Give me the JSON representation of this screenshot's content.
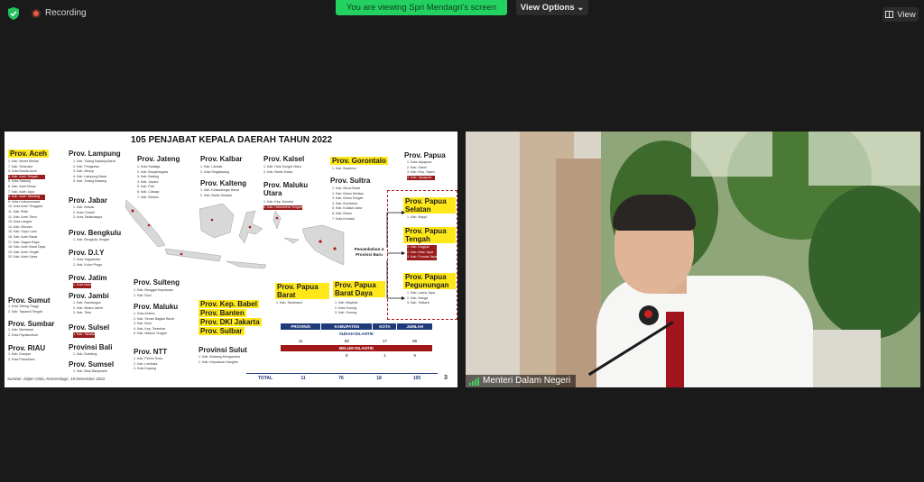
{
  "topbar": {
    "recording_label": "Recording",
    "share_banner": "You are viewing Spri Mendagri's screen",
    "view_options": "View Options",
    "view_label": "View"
  },
  "slide": {
    "title": "105 PENJABAT KEPALA DAERAH TAHUN 2022",
    "provinces": [
      {
        "name": "Prov. Aceh",
        "items": [
          "1. Kab. Bener Meriah",
          "7. Kab. Simeulue",
          "3. Kota Banda Aceh",
          "4. Kab. Aceh Tengah",
          "5. Kota Sabang",
          "6. Kab. Aceh Besar",
          "7. Kab. Aceh Jaya",
          "8. Kab. Aceh Tamiang",
          "9. Kota Lhokseumawe",
          "10. Kota Aceh Tenggara",
          "11. Kab. Pidie",
          "12. Kab. Aceh Timur",
          "13. Kota Langsa",
          "14. Kab. Bireuen",
          "15. Kab. Gayo Lues",
          "16. Kab. Aceh Barat",
          "17. Kab. Nagan Raya",
          "18. Kab. Aceh Barat Daya",
          "19. Kab. Aceh Singkil",
          "20. Kab. Aceh Utara"
        ]
      },
      {
        "name": "Prov. Sumut",
        "items": [
          "1. Kota Tebing Tinggi",
          "2. Kab. Tapanuli Tengah"
        ]
      },
      {
        "name": "Prov. Sumbar",
        "items": [
          "1. Kab. Mentawai",
          "2. Kota Payakumbuh"
        ]
      },
      {
        "name": "Prov. RIAU",
        "items": [
          "1. Kab. Kampar",
          "2. Kota Pekanbaru"
        ]
      },
      {
        "name": "Prov. Lampung",
        "items": [
          "1. Kab. Tulang Bawang Barat",
          "2. Kab. Pringsewu",
          "3. Kab. Mesuji",
          "4. Kab. Lampung Barat",
          "5. Kab. Tulang Bawang"
        ]
      },
      {
        "name": "Prov. Jabar",
        "items": [
          "1. Kab. Bekasi",
          "2. Kota Cimahi",
          "3. Kota Tasikmalaya"
        ]
      },
      {
        "name": "Prov. Bengkulu",
        "items": [
          "1. Kab. Bengkulu Tengah"
        ]
      },
      {
        "name": "Prov. D.I.Y",
        "items": [
          "1. Kota Yogyakarta",
          "2. Kab. Kulon Progo"
        ]
      },
      {
        "name": "Prov. Jatim",
        "items": [
          "1. Kota Batu"
        ]
      },
      {
        "name": "Prov. Jambi",
        "items": [
          "1. Kab. Sarolangun",
          "2. Kab. Muaro Jambi",
          "3. Kab. Tebo"
        ]
      },
      {
        "name": "Prov. Sulsel",
        "items": [
          "1. Kab. Takalar"
        ]
      },
      {
        "name": "Provinsi Bali",
        "items": [
          "1. Kab. Buleleng"
        ]
      },
      {
        "name": "Prov. Sumsel",
        "items": [
          "1. Kab. Musi Banyuasin"
        ]
      },
      {
        "name": "Prov. Jateng",
        "items": [
          "1. Kota Salatiga",
          "2. Kab. Banjarnegara",
          "3. Kab. Batang",
          "4. Kab. Jepara",
          "5. Kab. Pati",
          "6. Kab. Cilacap",
          "7. Kab. Brebes"
        ]
      },
      {
        "name": "Prov. Kalbar",
        "items": [
          "1. Kab. Landak",
          "2. Kota Singkawang"
        ]
      },
      {
        "name": "Prov. Kalteng",
        "items": [
          "1. Kab. Kotawaringin Barat",
          "2. Kab. Barito Selatan"
        ]
      },
      {
        "name": "Prov. Kalsel",
        "items": [
          "1. Kab. Hulu Sungai Utara",
          "2. Kab. Barito Kuala"
        ]
      },
      {
        "name": "Prov. Maluku Utara",
        "items": [
          "1. Kab. Kep. Morotai",
          "2. Kab. Halmahera Tengah"
        ]
      },
      {
        "name": "Prov. Sulteng",
        "items": [
          "1. Kab. Banggai Kepulauan",
          "2. Kab. Buol"
        ]
      },
      {
        "name": "Prov. Maluku",
        "items": [
          "1. Kota Ambon",
          "2. Kab. Seram Bagian Barat",
          "3. Kab. Buru",
          "4. Kab. Kep. Tanimbar",
          "5. Kab. Maluku Tengah"
        ]
      },
      {
        "name": "Prov. NTT",
        "items": [
          "1. Kab. Flores Timur",
          "2. Kab. Lembata",
          "3. Kota Kupang"
        ]
      },
      {
        "name": "Provinsi Sulut",
        "items": [
          "1. Kab. Bolaang Mongondow",
          "2. Kab. Kepulauan Sangihe"
        ]
      },
      {
        "name": "Prov. Gorontalo",
        "items": [
          "1. Kab. Boalemo"
        ]
      },
      {
        "name": "Prov. Sultra",
        "items": [
          "1. Kab. Muna Barat",
          "2. Kab. Buton Selatan",
          "3. Kab. Buton Tengah",
          "4. Kab. Bombana",
          "5. Kab. Kolaka Utara",
          "6. Kab. Buton",
          "7. Kota Kendari"
        ]
      },
      {
        "name": "Prov. Papua",
        "items": [
          "1. Kota Jayapura",
          "2. Kab. Sarmi",
          "3. Kab. Kep. Yapen",
          "4. Kab. Jayapura"
        ]
      },
      {
        "name": "Prov. Papua Selatan",
        "items": [
          "1. Kab. Mappi"
        ]
      },
      {
        "name": "Prov. Papua Tengah",
        "items": [
          "1. Kab. Dogiyai",
          "2. Kab. Intan Jaya",
          "3. Kab. Puncak Jaya"
        ]
      },
      {
        "name": "Prov. Papua Pegunungan",
        "items": [
          "1. Kab. Lanny Jaya",
          "2. Kab. Nduga",
          "3. Kab. Tolikara"
        ]
      },
      {
        "name": "Prov. Papua Barat",
        "items": [
          "1. Kab. Tambrauw"
        ]
      },
      {
        "name": "Prov. Papua Barat Daya",
        "items": [
          "1. Kab. Maybrat",
          "2. Kota Sorong",
          "3. Kab. Sorong"
        ]
      }
    ],
    "highlight_group": [
      "Prov. Kep. Babel",
      "Prov. Banten",
      "Prov. DKI Jakarta",
      "Prov. Sulbar"
    ],
    "penambahan": "Penambahan 4 Provinsi Baru",
    "table": {
      "headers": [
        "PROVINSI",
        "KABUPATEN",
        "KOTA",
        "JUMLAH"
      ],
      "sudah_label": "SUDAH DILANTIK",
      "sudah_values": [
        "11",
        "68",
        "17",
        "96"
      ],
      "belum_label": "BELUM DILANTIK",
      "belum_values": [
        "",
        "8",
        "1",
        "9"
      ],
      "total_label": "TOTAL",
      "total_values": [
        "11",
        "76",
        "18",
        "105"
      ]
    },
    "source": "Sumber: Ditjen Otda, Kemendagri, 19 Desember 2022",
    "page_number": "3"
  },
  "video": {
    "participant_name": "Menteri Dalam Negeri"
  },
  "colors": {
    "share_green": "#23d160",
    "highlight_yellow": "#ffe81a",
    "table_blue": "#1e3a78",
    "table_red": "#a01818",
    "record_red": "#e25d4a"
  }
}
